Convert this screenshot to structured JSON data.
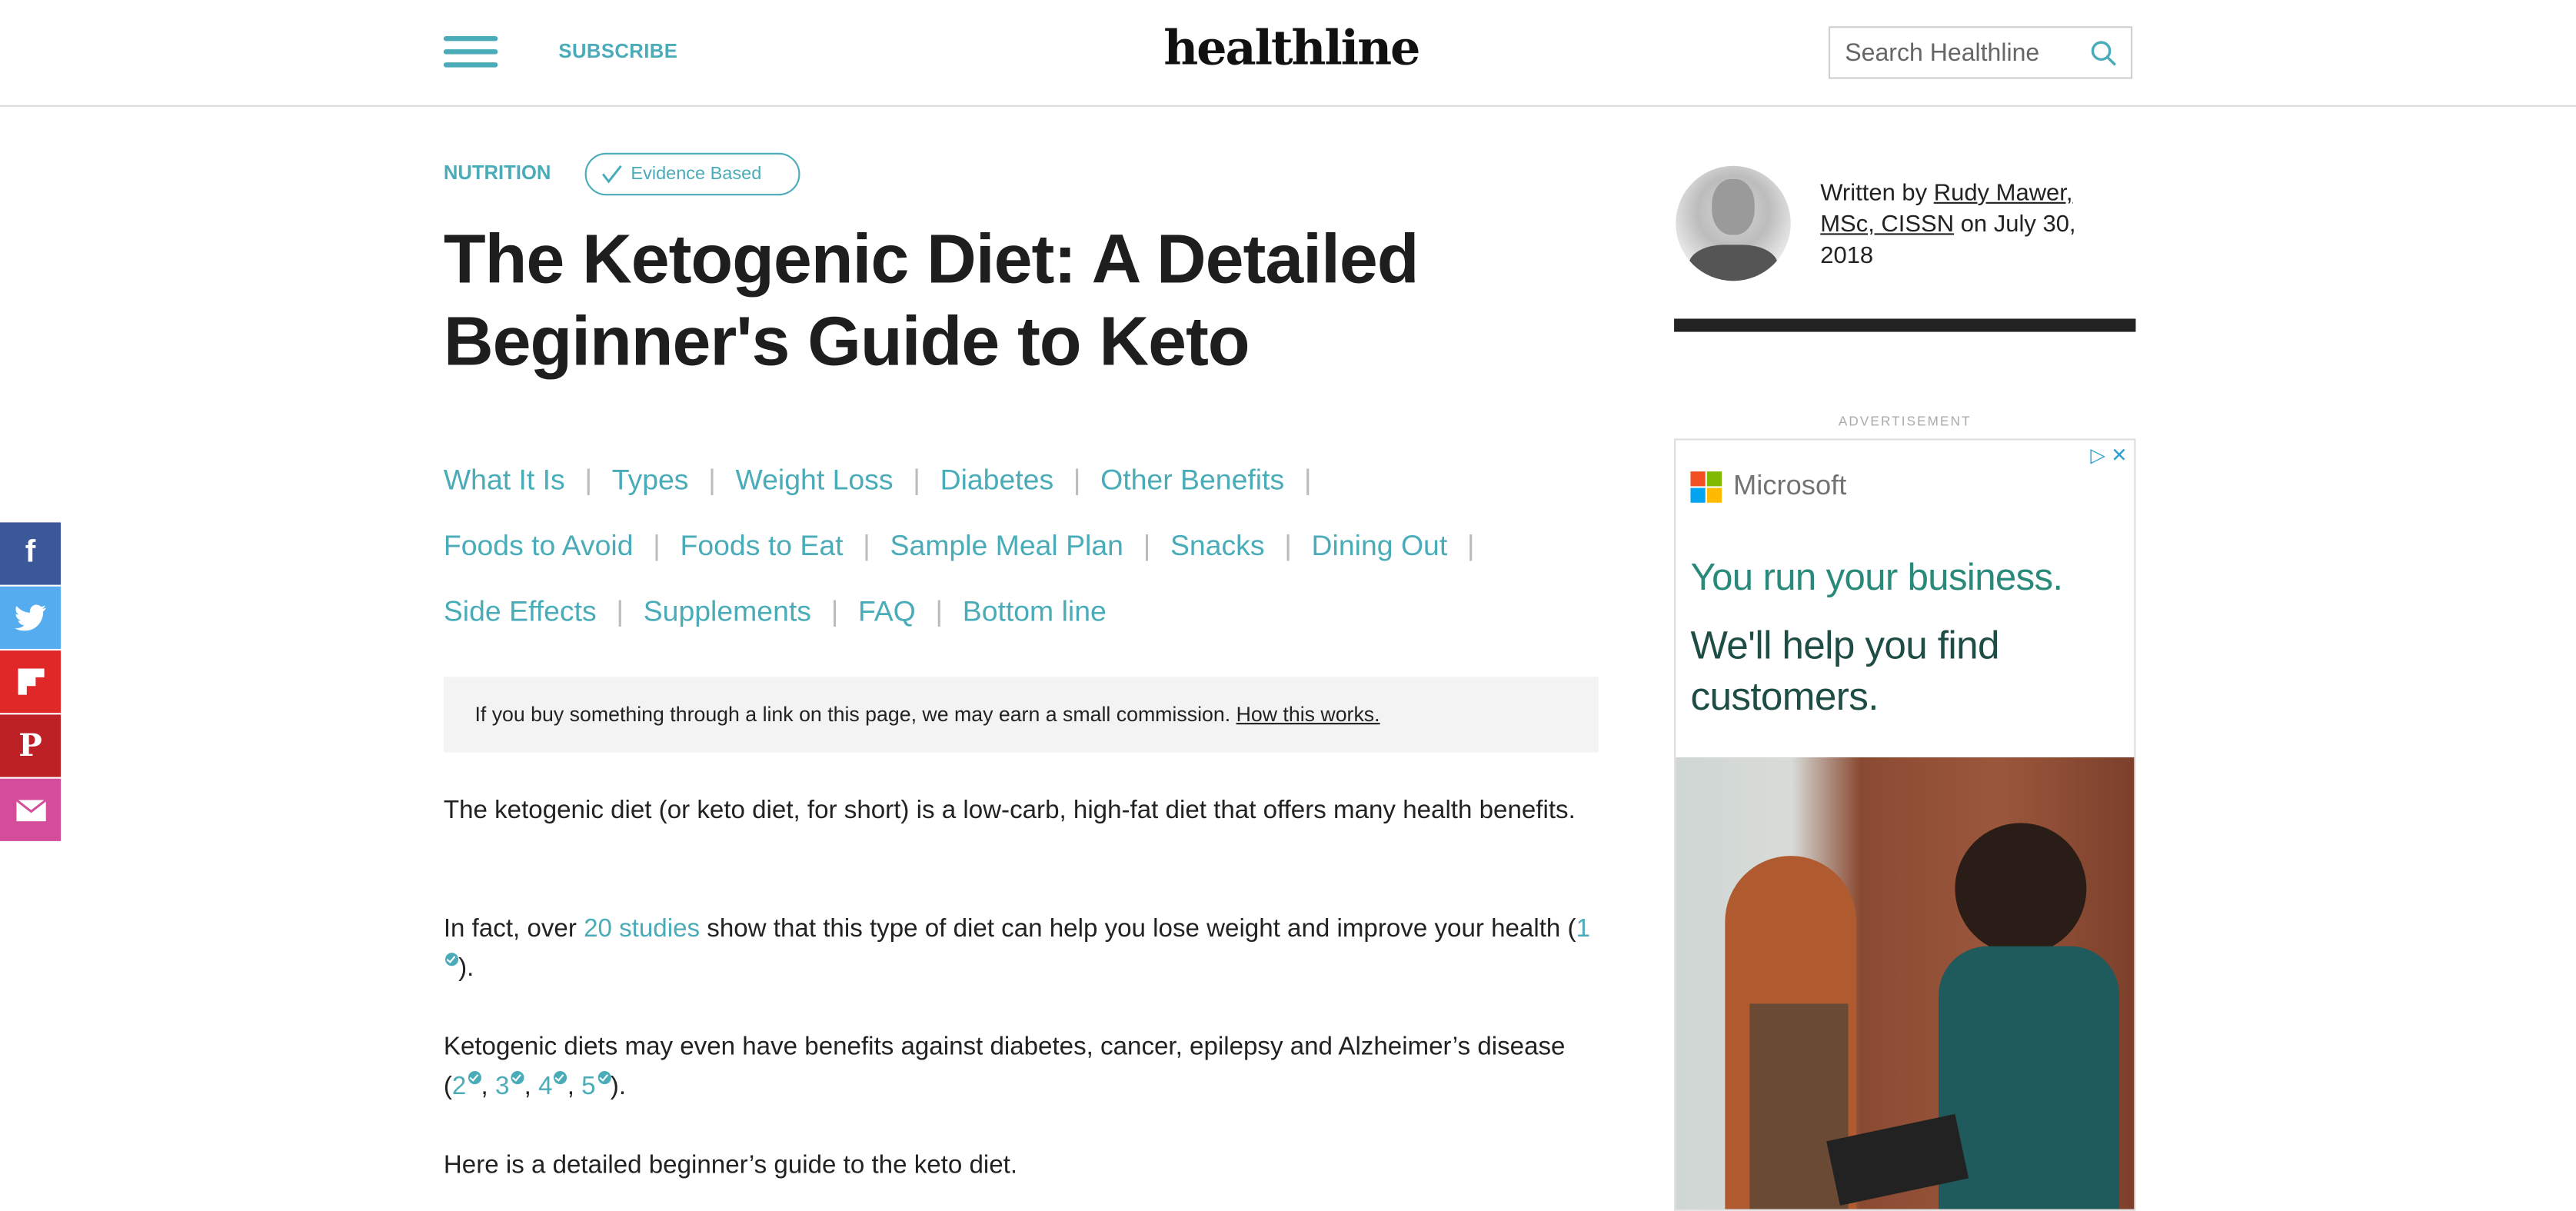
{
  "header": {
    "subscribe_label": "SUBSCRIBE",
    "logo": "healthline",
    "search_placeholder": "Search Healthline"
  },
  "article": {
    "category": "NUTRITION",
    "badge": "Evidence Based",
    "title": "The Ketogenic Diet: A Detailed Beginner's Guide to Keto",
    "toc": [
      "What It Is",
      "Types",
      "Weight Loss",
      "Diabetes",
      "Other Benefits",
      "Foods to Avoid",
      "Foods to Eat",
      "Sample Meal Plan",
      "Snacks",
      "Dining Out",
      "Side Effects",
      "Supplements",
      "FAQ",
      "Bottom line"
    ],
    "disclosure_text": "If you buy something through a link on this page, we may earn a small commission.",
    "disclosure_link": "How this works.",
    "p1": "The ketogenic diet (or keto diet, for short) is a low-carb, high-fat diet that offers many health benefits.",
    "p2_a": "In fact, over ",
    "p2_link": "20 studies",
    "p2_b": " show that this type of diet can help you lose weight and improve your health (",
    "p2_ref": "1",
    "p2_c": ").",
    "p3_a": "Ketogenic diets may even have benefits against diabetes, cancer, epilepsy and Alzheimer’s disease (",
    "p3_refs": [
      "2",
      "3",
      "4",
      "5"
    ],
    "p3_sep": ", ",
    "p3_c": ").",
    "p4": "Here is a detailed beginner’s guide to the keto diet."
  },
  "author": {
    "prefix": "Written by ",
    "name": "Rudy Mawer, MSc, CISSN",
    "suffix": " on July 30, 2018"
  },
  "ad": {
    "label": "ADVERTISEMENT",
    "brand": "Microsoft",
    "headline": "You run your business.",
    "subheadline": "We'll help you find customers."
  },
  "social": [
    {
      "icon": "facebook-icon",
      "color": "#3b5998"
    },
    {
      "icon": "twitter-icon",
      "color": "#55acee"
    },
    {
      "icon": "flipboard-icon",
      "color": "#e12828"
    },
    {
      "icon": "pinterest-icon",
      "color": "#bd2126"
    },
    {
      "icon": "email-icon",
      "color": "#d44d9b"
    }
  ],
  "colors": {
    "accent": "#4aacb8"
  }
}
